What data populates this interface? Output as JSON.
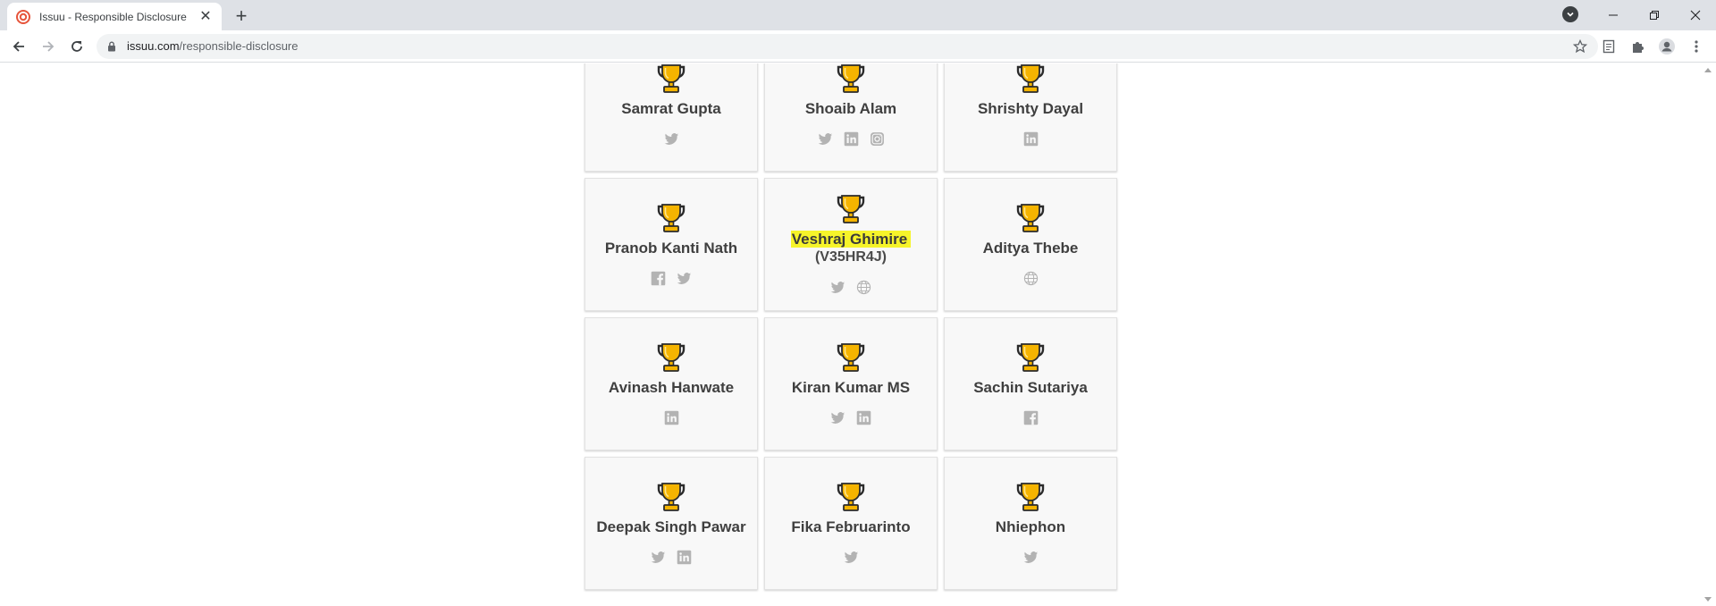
{
  "browser": {
    "tab_title": "Issuu - Responsible Disclosure",
    "url_domain": "issuu.com",
    "url_path": "/responsible-disclosure",
    "favicon": "issuu-logo-icon",
    "new_tab_symbol": "+",
    "close_symbol": "✕"
  },
  "colors": {
    "trophy_gold": "#f5b400",
    "highlight": "#f6f42a",
    "social_icon": "#b3b3b3",
    "card_bg": "#f8f8f8"
  },
  "researchers": [
    {
      "name": "Samrat Gupta",
      "handle": "",
      "socials": [
        "twitter"
      ]
    },
    {
      "name": "Shoaib Alam",
      "handle": "",
      "socials": [
        "twitter",
        "linkedin",
        "instagram"
      ]
    },
    {
      "name": "Shrishty Dayal",
      "handle": "",
      "socials": [
        "linkedin"
      ]
    },
    {
      "name": "Pranob Kanti Nath",
      "handle": "",
      "socials": [
        "facebook",
        "twitter"
      ]
    },
    {
      "name": "Veshraj Ghimire",
      "handle": "(V35HR4J)",
      "highlighted": true,
      "socials": [
        "twitter",
        "website"
      ]
    },
    {
      "name": "Aditya Thebe",
      "handle": "",
      "socials": [
        "website"
      ]
    },
    {
      "name": "Avinash Hanwate",
      "handle": "",
      "socials": [
        "linkedin"
      ]
    },
    {
      "name": "Kiran Kumar MS",
      "handle": "",
      "socials": [
        "twitter",
        "linkedin"
      ]
    },
    {
      "name": "Sachin Sutariya",
      "handle": "",
      "socials": [
        "facebook"
      ]
    },
    {
      "name": "Deepak Singh Pawar",
      "handle": "",
      "socials": [
        "twitter",
        "linkedin"
      ]
    },
    {
      "name": "Fika Februarinto",
      "handle": "",
      "socials": [
        "twitter"
      ]
    },
    {
      "name": "Nhiephon",
      "handle": "",
      "socials": [
        "twitter"
      ]
    }
  ]
}
